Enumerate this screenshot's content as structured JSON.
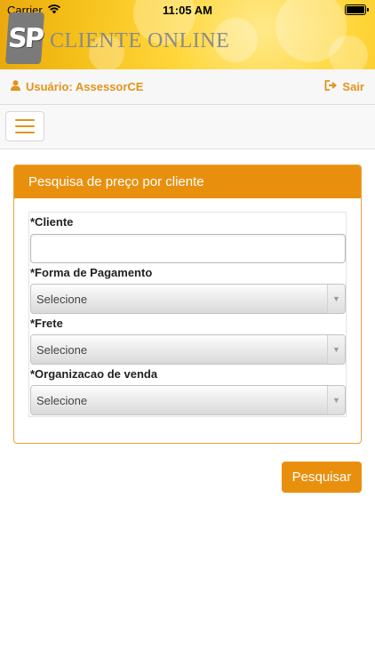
{
  "status_bar": {
    "carrier": "Carrier",
    "time": "11:05 AM"
  },
  "brand": {
    "logo_mark": "SP",
    "name": "CLIENTE ONLINE"
  },
  "user_bar": {
    "user_label": "Usuário: AssessorCE",
    "logout_label": "Sair"
  },
  "panel": {
    "title": "Pesquisa de preço por cliente",
    "fields": {
      "cliente": {
        "label": "*Cliente",
        "value": "",
        "placeholder": ""
      },
      "forma_pagamento": {
        "label": "*Forma de Pagamento",
        "selected": "Selecione"
      },
      "frete": {
        "label": "*Frete",
        "selected": "Selecione"
      },
      "organizacao_venda": {
        "label": "*Organizacao de venda",
        "selected": "Selecione"
      }
    }
  },
  "actions": {
    "search_label": "Pesquisar"
  },
  "colors": {
    "accent": "#e8900e",
    "accent_text": "#e3931b",
    "banner": "#f4bd16"
  },
  "icons": {
    "user": "user-icon",
    "logout": "sign-out-icon",
    "menu": "hamburger-menu-icon",
    "wifi": "wifi-icon",
    "battery": "battery-icon",
    "dropdown": "caret-down-icon"
  }
}
